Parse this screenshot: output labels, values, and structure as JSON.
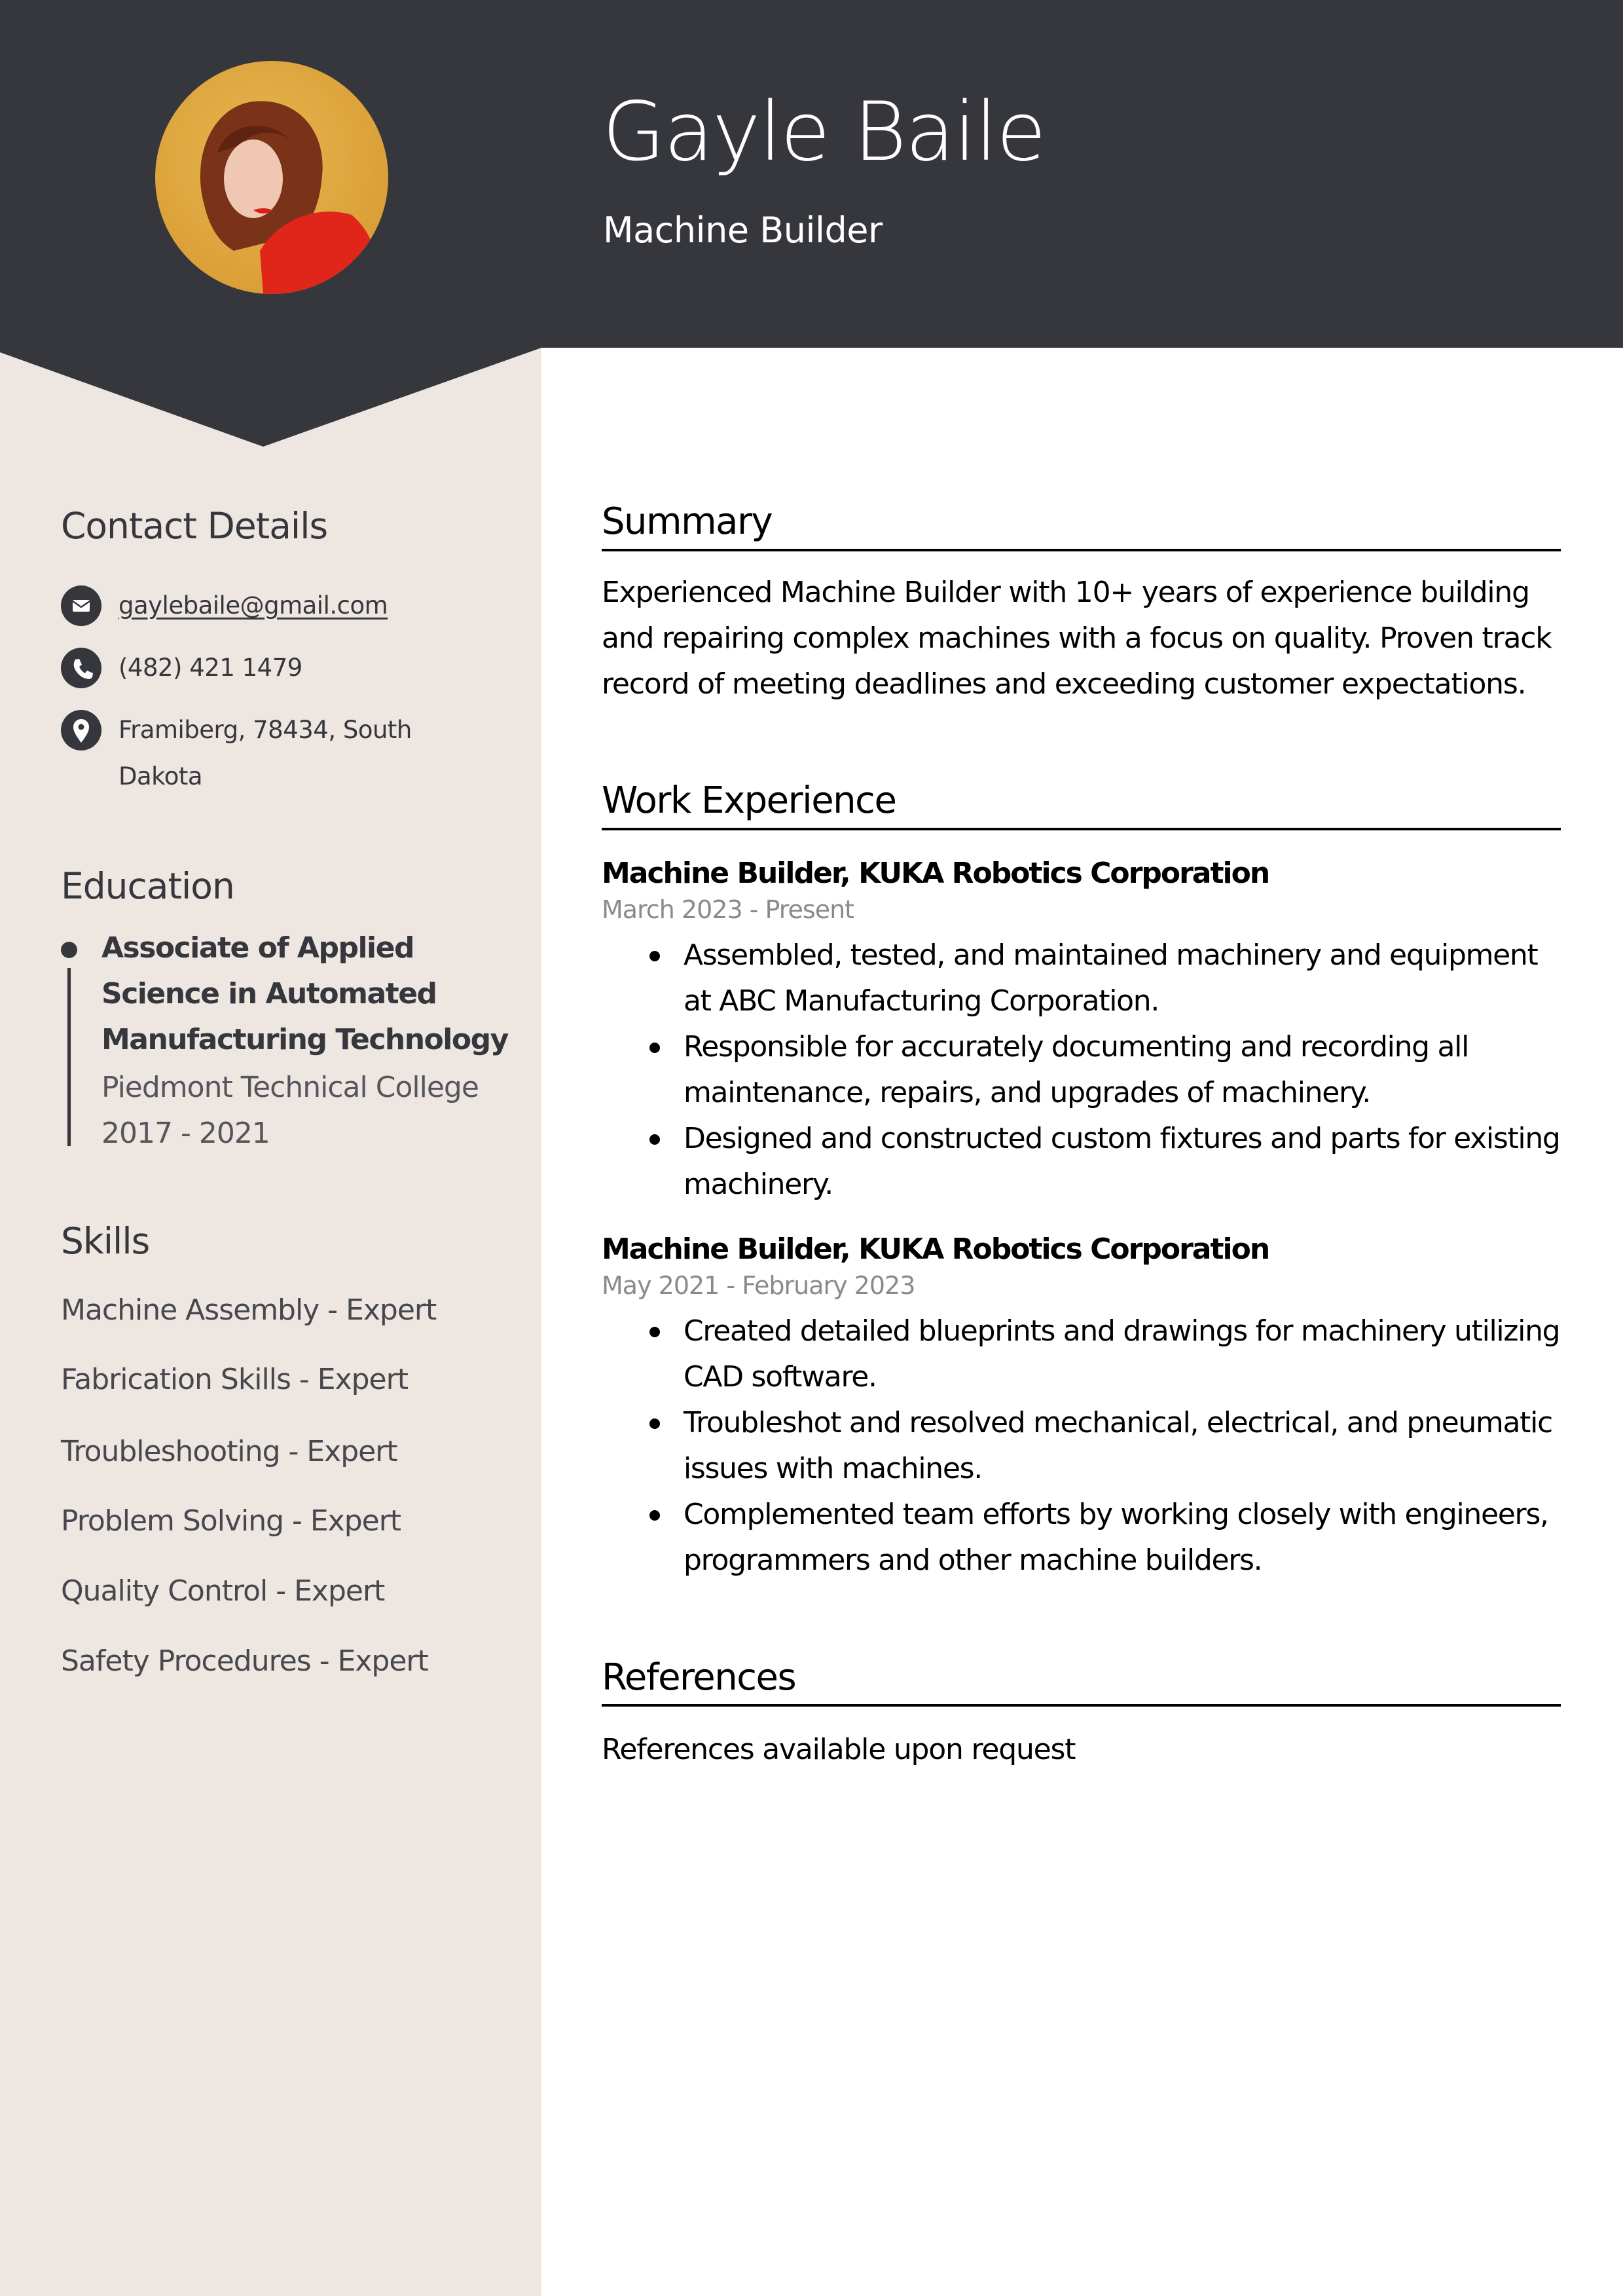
{
  "header": {
    "name": "Gayle Baile",
    "title": "Machine Builder",
    "photo_alt": "profile-photo"
  },
  "colors": {
    "header_bg": "#36373d",
    "sidebar_bg": "#ede6e1",
    "date_text": "#8a8a8a"
  },
  "sidebar": {
    "contact": {
      "heading": "Contact Details",
      "items": [
        {
          "icon": "envelope-icon",
          "text": "gaylebaile@gmail.com"
        },
        {
          "icon": "phone-icon",
          "text": "(482) 421 1479"
        },
        {
          "icon": "map-pin-icon",
          "text_line1": "Framiberg, 78434, South",
          "text_line2": "Dakota"
        }
      ]
    },
    "education": {
      "heading": "Education",
      "degree": "Associate of Applied Science in Automated Manufacturing Technology",
      "school": "Piedmont Technical College",
      "years": "2017 - 2021"
    },
    "skills": {
      "heading": "Skills",
      "items": [
        "Machine Assembly - Expert",
        "Fabrication Skills - Expert",
        "Troubleshooting - Expert",
        "Problem Solving - Expert",
        "Quality Control - Expert",
        "Safety Procedures - Expert"
      ]
    }
  },
  "main": {
    "summary": {
      "heading": "Summary",
      "text": "Experienced Machine Builder with 10+ years of experience building and repairing complex machines with a focus on quality. Proven track record of meeting deadlines and exceeding customer expectations."
    },
    "experience": {
      "heading": "Work Experience",
      "jobs": [
        {
          "title": "Machine Builder, KUKA Robotics Corporation",
          "dates": "March 2023 - Present",
          "bullets": [
            "Assembled, tested, and maintained machinery and equipment at ABC Manufacturing Corporation.",
            "Responsible for accurately documenting and recording all maintenance, repairs, and upgrades of machinery.",
            "Designed and constructed custom fixtures and parts for existing machinery."
          ]
        },
        {
          "title": "Machine Builder, KUKA Robotics Corporation",
          "dates": "May 2021 - February 2023",
          "bullets": [
            "Created detailed blueprints and drawings for machinery utilizing CAD software.",
            "Troubleshot and resolved mechanical, electrical, and pneumatic issues with machines.",
            "Complemented team efforts by working closely with engineers, programmers and other machine builders."
          ]
        }
      ]
    },
    "references": {
      "heading": "References",
      "text": "References available upon request"
    }
  }
}
